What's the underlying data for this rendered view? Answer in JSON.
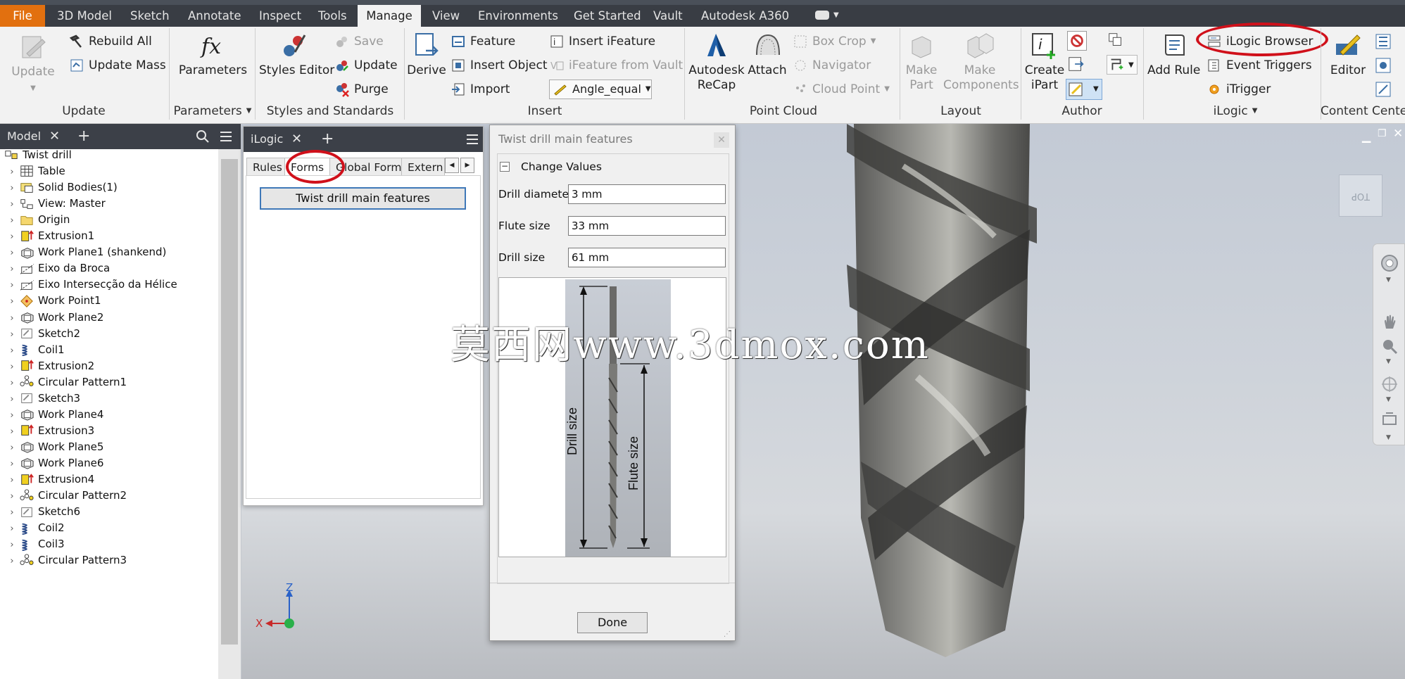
{
  "menu": {
    "items": [
      "File",
      "3D Model",
      "Sketch",
      "Annotate",
      "Inspect",
      "Tools",
      "Manage",
      "View",
      "Environments",
      "Get Started",
      "Vault",
      "Autodesk A360"
    ],
    "active": "Manage"
  },
  "ribbon": {
    "update": {
      "update": "Update",
      "rebuild_all": "Rebuild All",
      "update_mass": "Update Mass",
      "title": "Update"
    },
    "parameters": {
      "parameters": "Parameters",
      "title": "Parameters"
    },
    "styles": {
      "styles_editor": "Styles Editor",
      "save": "Save",
      "update": "Update",
      "purge": "Purge",
      "title": "Styles and Standards"
    },
    "insert": {
      "derive": "Derive",
      "feature": "Feature",
      "insert_object": "Insert Object",
      "import": "Import",
      "insert_ifeature": "Insert iFeature",
      "ifeature_from_vault": "iFeature from Vault",
      "angle_select": "Angle_equal",
      "title": "Insert"
    },
    "point_cloud": {
      "recap_line1": "Autodesk",
      "recap_line2": "ReCap",
      "attach": "Attach",
      "box_crop": "Box Crop",
      "navigator": "Navigator",
      "cloud_point": "Cloud Point",
      "title": "Point Cloud"
    },
    "layout": {
      "make_part_1": "Make",
      "make_part_2": "Part",
      "make_components_1": "Make",
      "make_components_2": "Components",
      "title": "Layout"
    },
    "author": {
      "create_ipart_1": "Create",
      "create_ipart_2": "iPart",
      "title": "Author"
    },
    "ilogic": {
      "add_rule": "Add Rule",
      "ilogic_browser": "iLogic Browser",
      "event_triggers": "Event Triggers",
      "itrigger": "iTrigger",
      "title": "iLogic"
    },
    "content_center": {
      "editor": "Editor",
      "title": "Content Center"
    }
  },
  "browser": {
    "tab": "Model",
    "items": [
      {
        "label": "Twist drill",
        "icon": "assembly-icon",
        "root": true
      },
      {
        "label": "Table",
        "icon": "table-icon"
      },
      {
        "label": "Solid Bodies(1)",
        "icon": "solid-bodies-icon"
      },
      {
        "label": "View: Master",
        "icon": "view-icon"
      },
      {
        "label": "Origin",
        "icon": "folder-icon"
      },
      {
        "label": "Extrusion1",
        "icon": "extrusion-icon"
      },
      {
        "label": "Work Plane1 (shankend)",
        "icon": "work-plane-icon"
      },
      {
        "label": "Eixo da Broca",
        "icon": "work-axis-icon"
      },
      {
        "label": "Eixo Intersecção da Hélice",
        "icon": "work-axis-icon"
      },
      {
        "label": "Work Point1",
        "icon": "work-point-icon"
      },
      {
        "label": "Work Plane2",
        "icon": "work-plane-icon"
      },
      {
        "label": "Sketch2",
        "icon": "sketch-icon"
      },
      {
        "label": "Coil1",
        "icon": "coil-icon"
      },
      {
        "label": "Extrusion2",
        "icon": "extrusion-icon"
      },
      {
        "label": "Circular Pattern1",
        "icon": "circular-pattern-icon"
      },
      {
        "label": "Sketch3",
        "icon": "sketch-icon"
      },
      {
        "label": "Work Plane4",
        "icon": "work-plane-icon"
      },
      {
        "label": "Extrusion3",
        "icon": "extrusion-icon"
      },
      {
        "label": "Work Plane5",
        "icon": "work-plane-icon"
      },
      {
        "label": "Work Plane6",
        "icon": "work-plane-icon"
      },
      {
        "label": "Extrusion4",
        "icon": "extrusion-icon"
      },
      {
        "label": "Circular Pattern2",
        "icon": "circular-pattern-icon"
      },
      {
        "label": "Sketch6",
        "icon": "sketch-icon"
      },
      {
        "label": "Coil2",
        "icon": "coil-icon"
      },
      {
        "label": "Coil3",
        "icon": "coil-icon"
      },
      {
        "label": "Circular Pattern3",
        "icon": "circular-pattern-icon"
      }
    ]
  },
  "ilogic_panel": {
    "tab": "iLogic",
    "tabs": [
      "Rules",
      "Forms",
      "Global Forms",
      "Extern"
    ],
    "active_tab": "Forms",
    "form_button": "Twist drill main features"
  },
  "form": {
    "title": "Twist drill main features",
    "group": "Change Values",
    "fields": [
      {
        "label": "Drill diameter",
        "value": "3 mm"
      },
      {
        "label": "Flute size",
        "value": "33 mm"
      },
      {
        "label": "Drill size",
        "value": "61 mm"
      }
    ],
    "image_labels": {
      "drill": "Drill size",
      "flute": "Flute size"
    },
    "done": "Done"
  },
  "viewport": {
    "view_cube_face": "TOP",
    "watermark": "莫西网www.3dmox.com",
    "axis_x": "X",
    "axis_z": "Z"
  },
  "colors": {
    "menubar": "#393d44",
    "file_tab": "#e2700f",
    "highlight": "#d0101a",
    "ribbon": "#f2f2f2"
  }
}
